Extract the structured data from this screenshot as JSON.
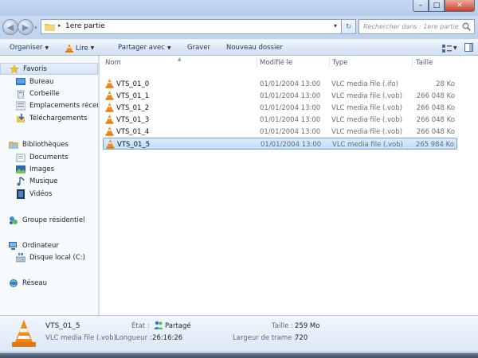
{
  "window": {
    "buttons": {
      "minimize": "–",
      "maximize": "□",
      "close": "✕"
    }
  },
  "address": {
    "path": "1ere partie",
    "separator": "▸",
    "search_placeholder": "Rechercher dans : 1ere partie",
    "refresh_glyph": "↻"
  },
  "toolbar": {
    "organize": "Organiser",
    "play": "Lire",
    "share": "Partager avec",
    "burn": "Graver",
    "new_folder": "Nouveau dossier"
  },
  "nav": {
    "favorites": "Favoris",
    "desktop": "Bureau",
    "recycle": "Corbeille",
    "recent": "Emplacements récents",
    "downloads": "Téléchargements",
    "libraries": "Bibliothèques",
    "documents": "Documents",
    "images": "Images",
    "music": "Musique",
    "videos": "Vidéos",
    "homegroup": "Groupe résidentiel",
    "computer": "Ordinateur",
    "local_disk": "Disque local (C:)",
    "network": "Réseau"
  },
  "columns": {
    "name": "Nom",
    "modified": "Modifié le",
    "type": "Type",
    "size": "Taille"
  },
  "files": [
    {
      "name": "VTS_01_0",
      "modified": "01/01/2004 13:00",
      "type": "VLC media file (.ifo)",
      "size": "28 Ko"
    },
    {
      "name": "VTS_01_1",
      "modified": "01/01/2004 13:00",
      "type": "VLC media file (.vob)",
      "size": "266 048 Ko"
    },
    {
      "name": "VTS_01_2",
      "modified": "01/01/2004 13:00",
      "type": "VLC media file (.vob)",
      "size": "266 048 Ko"
    },
    {
      "name": "VTS_01_3",
      "modified": "01/01/2004 13:00",
      "type": "VLC media file (.vob)",
      "size": "266 048 Ko"
    },
    {
      "name": "VTS_01_4",
      "modified": "01/01/2004 13:00",
      "type": "VLC media file (.vob)",
      "size": "266 048 Ko"
    },
    {
      "name": "VTS_01_5",
      "modified": "01/01/2004 13:00",
      "type": "VLC media file (.vob)",
      "size": "265 984 Ko"
    }
  ],
  "selected_index": 5,
  "details": {
    "name": "VTS_01_5",
    "type": "VLC media file (.vob)",
    "state_label": "État :",
    "state_value": "Partagé",
    "length_label": "Longueur :",
    "length_value": "26:16:26",
    "size_label": "Taille :",
    "size_value": "259 Mo",
    "framewidth_label": "Largeur de trame :",
    "framewidth_value": "720"
  },
  "colors": {
    "vlc_orange": "#f08a1c",
    "selection": "#c1dcfc",
    "toolbar_text": "#1e395b"
  }
}
